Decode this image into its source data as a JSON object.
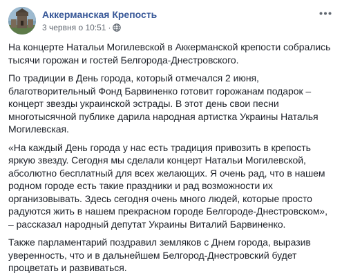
{
  "post": {
    "page_name": "Аккерманская Крепость",
    "timestamp": "3 червня о 10:51",
    "separator": "·",
    "privacy_icon": "globe-icon",
    "more_icon": "more-options-icon",
    "paragraphs": [
      "На концерте Натальи Могилевской в Аккерманской крепости собрались тысячи горожан и гостей Белгорода-Днестровского.",
      "По традиции в День города, который отмечался 2 июня, благотворительный Фонд Барвиненко готовит горожанам подарок – концерт звезды украинской эстрады. В этот день свои песни многотысячной публике дарила народная артистка Украины Наталья Могилевская.",
      "«На каждый День города у нас есть традиция привозить в крепость яркую звезду. Сегодня мы сделали концерт Натальи Могилевской, абсолютно бесплатный для всех желающих. Я очень рад, что в нашем родном городе есть такие праздники и рад возможности их организовывать. Здесь сегодня очень много людей, которые просто радуются жить в нашем прекрасном городе Белгороде-Днестровском», – рассказал народный депутат Украины Виталий Барвиненко.",
      "Также парламентарий поздравил земляков с Днем города, выразив уверенность, что и в дальнейшем Белгород-Днестровский будет процветать и развиваться."
    ]
  },
  "colors": {
    "link": "#385898",
    "text": "#1d2129",
    "secondary": "#606770",
    "background": "#ffffff"
  }
}
